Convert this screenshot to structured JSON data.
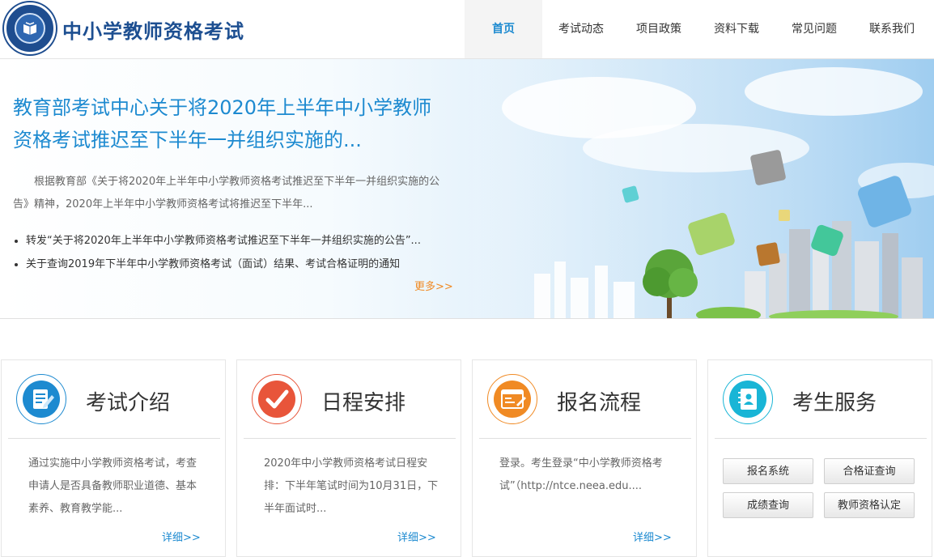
{
  "site": {
    "title": "中小学教师资格考试"
  },
  "nav": [
    {
      "label": "首页",
      "active": true
    },
    {
      "label": "考试动态"
    },
    {
      "label": "项目政策"
    },
    {
      "label": "资料下载"
    },
    {
      "label": "常见问题"
    },
    {
      "label": "联系我们"
    }
  ],
  "banner": {
    "headline": "教育部考试中心关于将2020年上半年中小学教师资格考试推迟至下半年一并组织实施的...",
    "summary": "根据教育部《关于将2020年上半年中小学教师资格考试推迟至下半年一并组织实施的公告》精神，2020年上半年中小学教师资格考试将推迟至下半年...",
    "links": [
      "转发“关于将2020年上半年中小学教师资格考试推迟至下半年一并组织实施的公告”...",
      "关于查询2019年下半年中小学教师资格考试（面试）结果、考试合格证明的通知"
    ],
    "more": "更多>>"
  },
  "cards": [
    {
      "title": "考试介绍",
      "icon": "document-edit-icon",
      "color": "#1d8ad0",
      "text": "通过实施中小学教师资格考试，考查申请人是否具备教师职业道德、基本素养、教育教学能...",
      "more": "详细>>"
    },
    {
      "title": "日程安排",
      "icon": "checkmark-icon",
      "color": "#e8553a",
      "text": "2020年中小学教师资格考试日程安排：下半年笔试时间为10月31日，下半年面试时...",
      "more": "详细>>"
    },
    {
      "title": "报名流程",
      "icon": "registration-form-icon",
      "color": "#f08a24",
      "text": "登录。考生登录“中小学教师资格考试”（http://ntce.neea.edu....",
      "more": "详细>>"
    },
    {
      "title": "考生服务",
      "icon": "contact-book-icon",
      "color": "#19b5d6",
      "buttons": [
        "报名系统",
        "合格证查询",
        "成绩查询",
        "教师资格认定"
      ]
    }
  ]
}
